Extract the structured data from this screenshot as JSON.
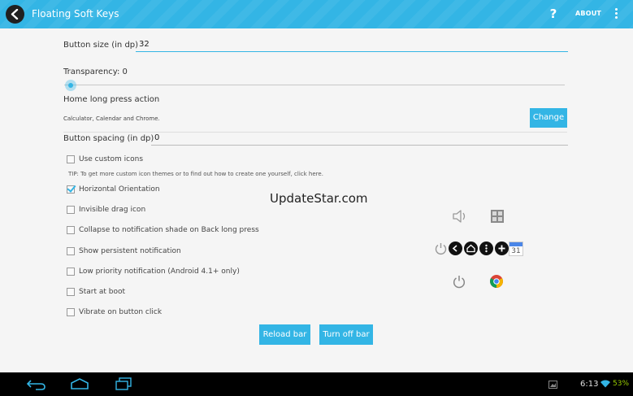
{
  "app": {
    "title": "Floating Soft Keys",
    "help_label": "?",
    "about_label": "ABOUT"
  },
  "settings": {
    "button_size_label": "Button size (in dp)",
    "button_size_value": "32",
    "transparency_label": "Transparency: 0",
    "transparency_value": 0,
    "home_long_press_label": "Home long press action",
    "home_long_press_desc": "Calculator, Calendar and Chrome.",
    "change_button": "Change",
    "button_spacing_label": "Button spacing (in dp)",
    "button_spacing_value": "0",
    "tip_text": "TIP: To get more custom icon themes or to find out how to create one yourself, click here."
  },
  "checkboxes": [
    {
      "label": "Use custom icons",
      "checked": false
    },
    {
      "label": "Horizontal Orientation",
      "checked": true
    },
    {
      "label": "Invisible drag icon",
      "checked": false
    },
    {
      "label": "Collapse to notification shade on Back long press",
      "checked": false
    },
    {
      "label": "Show persistent notification",
      "checked": false
    },
    {
      "label": "Low priority notification (Android 4.1+ only)",
      "checked": false
    },
    {
      "label": "Start at boot",
      "checked": false
    },
    {
      "label": "Vibrate on button click",
      "checked": false
    }
  ],
  "actions": {
    "reload": "Reload bar",
    "turn_off": "Turn off bar"
  },
  "watermark": "UpdateStar.com",
  "preview": {
    "icons": [
      "speaker-icon",
      "calculator-icon",
      "power-icon",
      "back-icon",
      "home-icon",
      "menu-icon",
      "plus-icon",
      "calendar-icon",
      "power-icon",
      "chrome-icon"
    ],
    "calendar_day": "31"
  },
  "status_bar": {
    "time": "6:13",
    "battery": "53%"
  },
  "colors": {
    "accent": "#33b5e5",
    "battery_text": "#99cc00"
  }
}
